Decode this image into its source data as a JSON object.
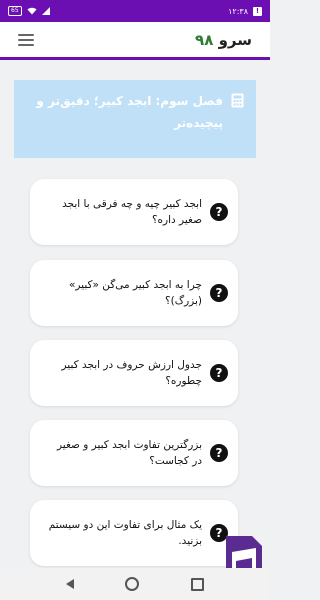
{
  "status_bar": {
    "time": "۱۲:۳۸",
    "battery": "65",
    "alert_glyph": "!"
  },
  "app_bar": {
    "title_word": "سرو",
    "title_number": "۹۸",
    "menu_icon": "hamburger-icon"
  },
  "chapter": {
    "title": "فصل سوم: ابجد کبیر؛ دقیق‌تر و پیچیده‌تر",
    "icon": "calculator-icon"
  },
  "questions": [
    {
      "text": "ابجد کبیر چیه و چه فرقی با ابجد صغیر داره؟",
      "icon": "question-icon"
    },
    {
      "text": "چرا به ابجد کبیر می‌گن «کبیر» (بزرگ)؟",
      "icon": "question-icon"
    },
    {
      "text": "جدول ارزش حروف در ابجد کبیر چطوره؟",
      "icon": "question-icon"
    },
    {
      "text": "بزرگترین تفاوت ابجد کبیر و صغیر در کجاست؟",
      "icon": "question-icon"
    },
    {
      "text": "یک مثال برای تفاوت این دو سیستم بزنید.",
      "icon": "question-icon"
    }
  ],
  "colors": {
    "status_bar": "#6b0fb3",
    "banner": "#bfe0f7",
    "title_number": "#2e7d32"
  }
}
